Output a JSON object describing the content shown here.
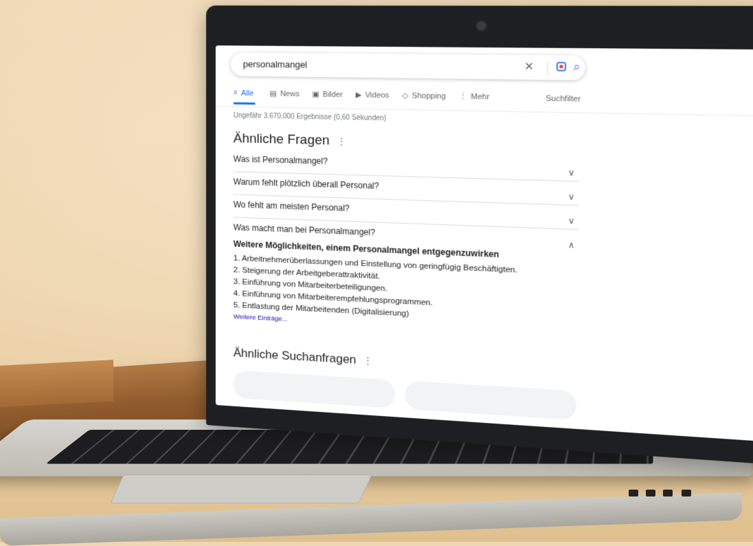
{
  "search": {
    "query": "personalmangel",
    "tabs": [
      {
        "label": "Alle",
        "icon": "search-icon",
        "active": true
      },
      {
        "label": "News",
        "icon": "news-icon",
        "active": false
      },
      {
        "label": "Bilder",
        "icon": "image-icon",
        "active": false
      },
      {
        "label": "Videos",
        "icon": "video-icon",
        "active": false
      },
      {
        "label": "Shopping",
        "icon": "tag-icon",
        "active": false
      },
      {
        "label": "Mehr",
        "icon": "more-vertical-icon",
        "active": false
      }
    ],
    "filter_label": "Suchfilter",
    "stats": "Ungefähr 3.670.000 Ergebnisse (0,60 Sekunden)"
  },
  "related_questions": {
    "title": "Ähnliche Fragen",
    "items": [
      {
        "text": "Was ist Personalmangel?"
      },
      {
        "text": "Warum fehlt plötzlich überall Personal?"
      },
      {
        "text": "Wo fehlt am meisten Personal?"
      },
      {
        "text": "Was macht man bei Personalmangel?"
      }
    ]
  },
  "answer": {
    "title": "Weitere Möglichkeiten, einem Personalmangel entgegenzuwirken",
    "items": [
      "1. Arbeitnehmerüberlassungen und Einstellung von geringfügig Beschäftigten.",
      "2. Steigerung der Arbeitgeberattraktivität.",
      "3. Einführung von Mitarbeiterbeteiligungen.",
      "4. Einführung von Mitarbeiterempfehlungsprogrammen.",
      "5. Entlastung der Mitarbeitenden (Digitalisierung)"
    ],
    "more_link": "Weitere Einträge..."
  },
  "related_searches": {
    "title": "Ähnliche Suchanfragen"
  },
  "colors": {
    "accent": "#1a73e8",
    "link": "#1a0dab",
    "background": "#ecd2aa"
  }
}
